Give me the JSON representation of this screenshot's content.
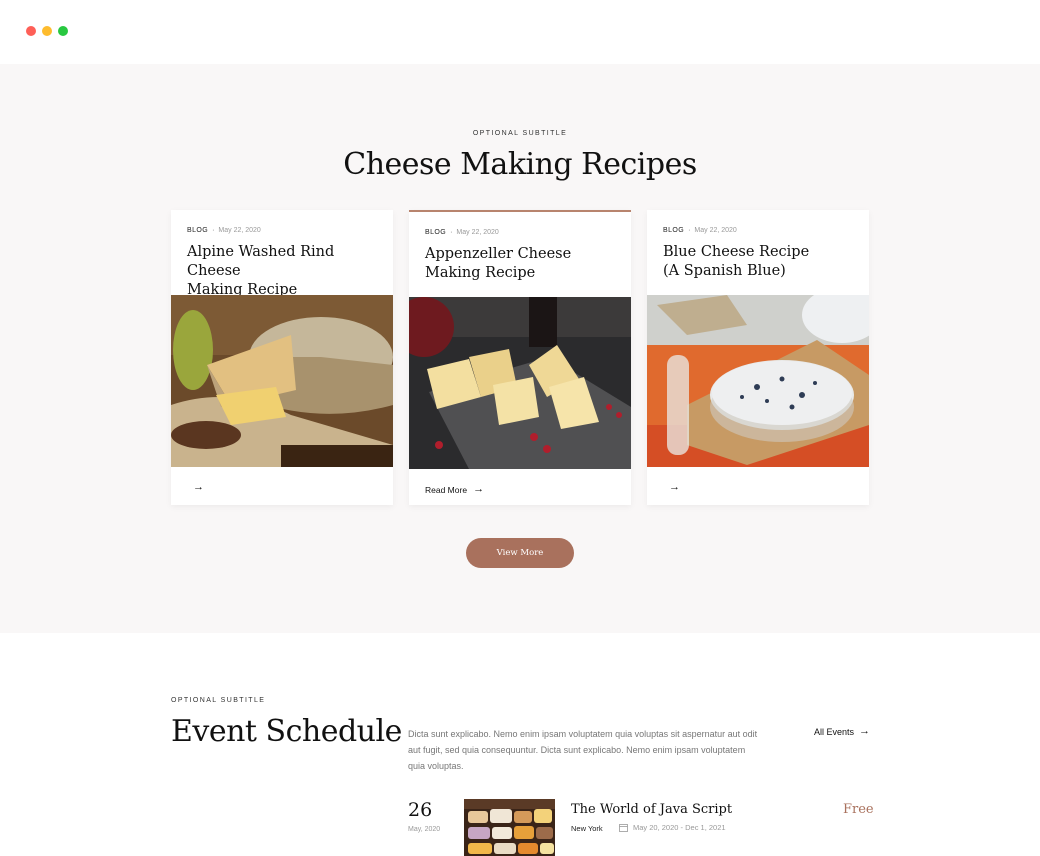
{
  "recipes": {
    "subtitle": "OPTIONAL SUBTITLE",
    "title": "Cheese Making Recipes",
    "cards": [
      {
        "category": "BLOG",
        "date": "May 22, 2020",
        "title_line1": "Alpine Washed Rind Cheese",
        "title_line2": "Making Recipe",
        "link_label": ""
      },
      {
        "category": "BLOG",
        "date": "May 22, 2020",
        "title_line1": "Appenzeller Cheese",
        "title_line2": "Making Recipe",
        "link_label": "Read More"
      },
      {
        "category": "BLOG",
        "date": "May 22, 2020",
        "title_line1": "Blue Cheese Recipe",
        "title_line2": "(A Spanish Blue)",
        "link_label": ""
      }
    ],
    "view_more_label": "View More",
    "arrow_icon": "arrow-right-icon"
  },
  "events": {
    "subtitle": "OPTIONAL SUBTITLE",
    "title": "Event Schedule",
    "description": "Dicta sunt explicabo. Nemo enim ipsam voluptatem quia voluptas sit aspernatur aut odit aut fugit, sed quia consequuntur. Dicta sunt explicabo. Nemo enim ipsam voluptatem quia voluptas.",
    "all_events_label": "All Events",
    "items": [
      {
        "day": "26",
        "month": "May, 2020",
        "title": "The World of Java Script",
        "location": "New York",
        "date_range": "May 20, 2020 - Dec 1, 2021",
        "price": "Free"
      }
    ]
  },
  "colors": {
    "accent": "#a9715d",
    "section_bg": "#f9f7f7",
    "window_dots": [
      "#fe5f57",
      "#febc2e",
      "#28c840"
    ]
  }
}
